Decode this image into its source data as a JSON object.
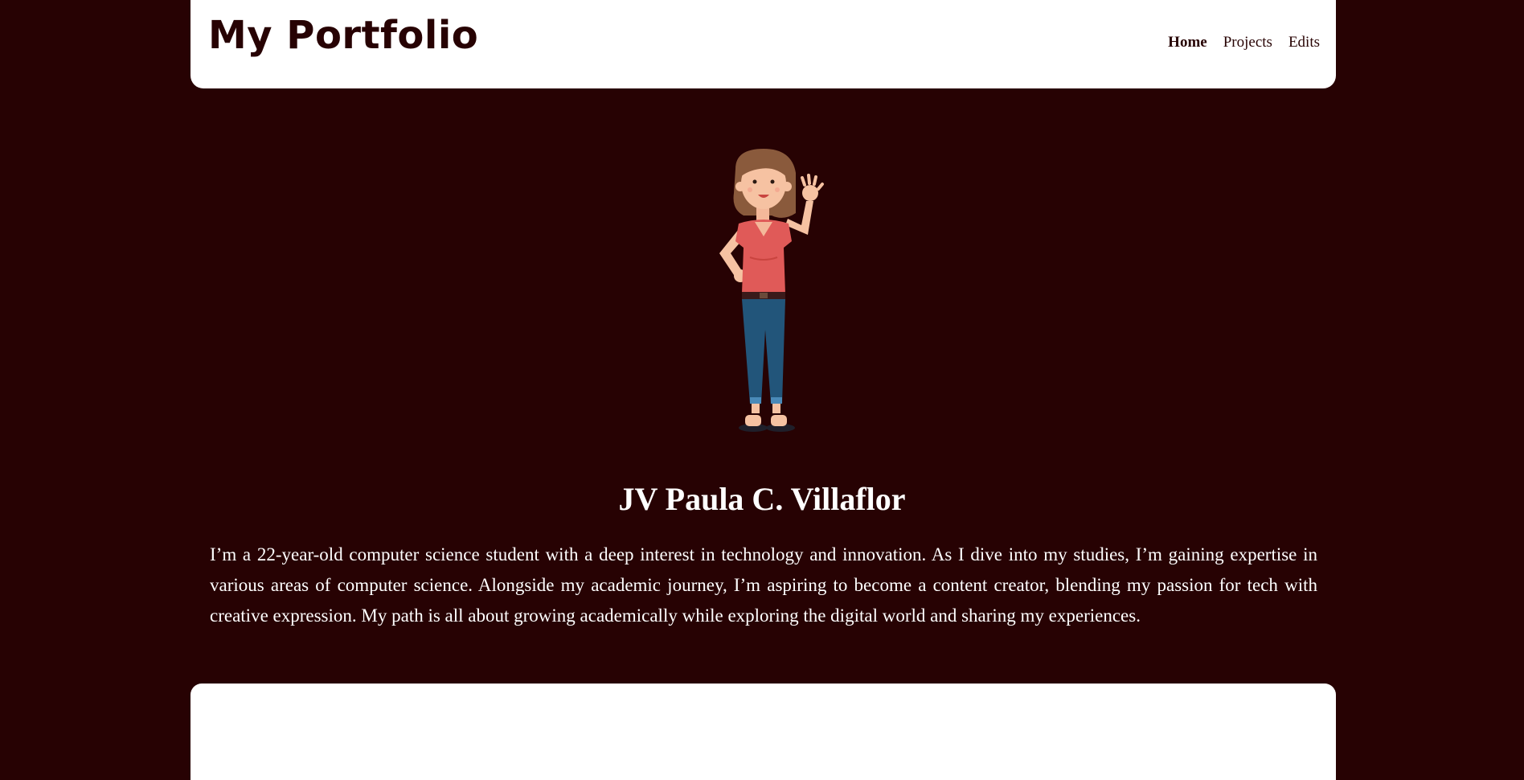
{
  "header": {
    "logo": "My Portfolio",
    "nav": [
      {
        "label": "Home",
        "active": true
      },
      {
        "label": "Projects",
        "active": false
      },
      {
        "label": "Edits",
        "active": false
      }
    ]
  },
  "hero": {
    "illustration": "waving-woman-avatar",
    "name": "JV Paula C. Villaflor",
    "bio": "I’m a 22-year-old computer science student with a deep interest in technology and innovation. As I dive into my studies, I’m gaining expertise in various areas of computer science. Alongside my academic journey, I’m aspiring to become a content creator, blending my passion for tech with creative expression. My path is all about growing academically while exploring the digital world and sharing my experiences."
  },
  "colors": {
    "background": "#270203",
    "header_bg": "#ffffff",
    "text_dark": "#270203",
    "text_light": "#ffffff"
  }
}
